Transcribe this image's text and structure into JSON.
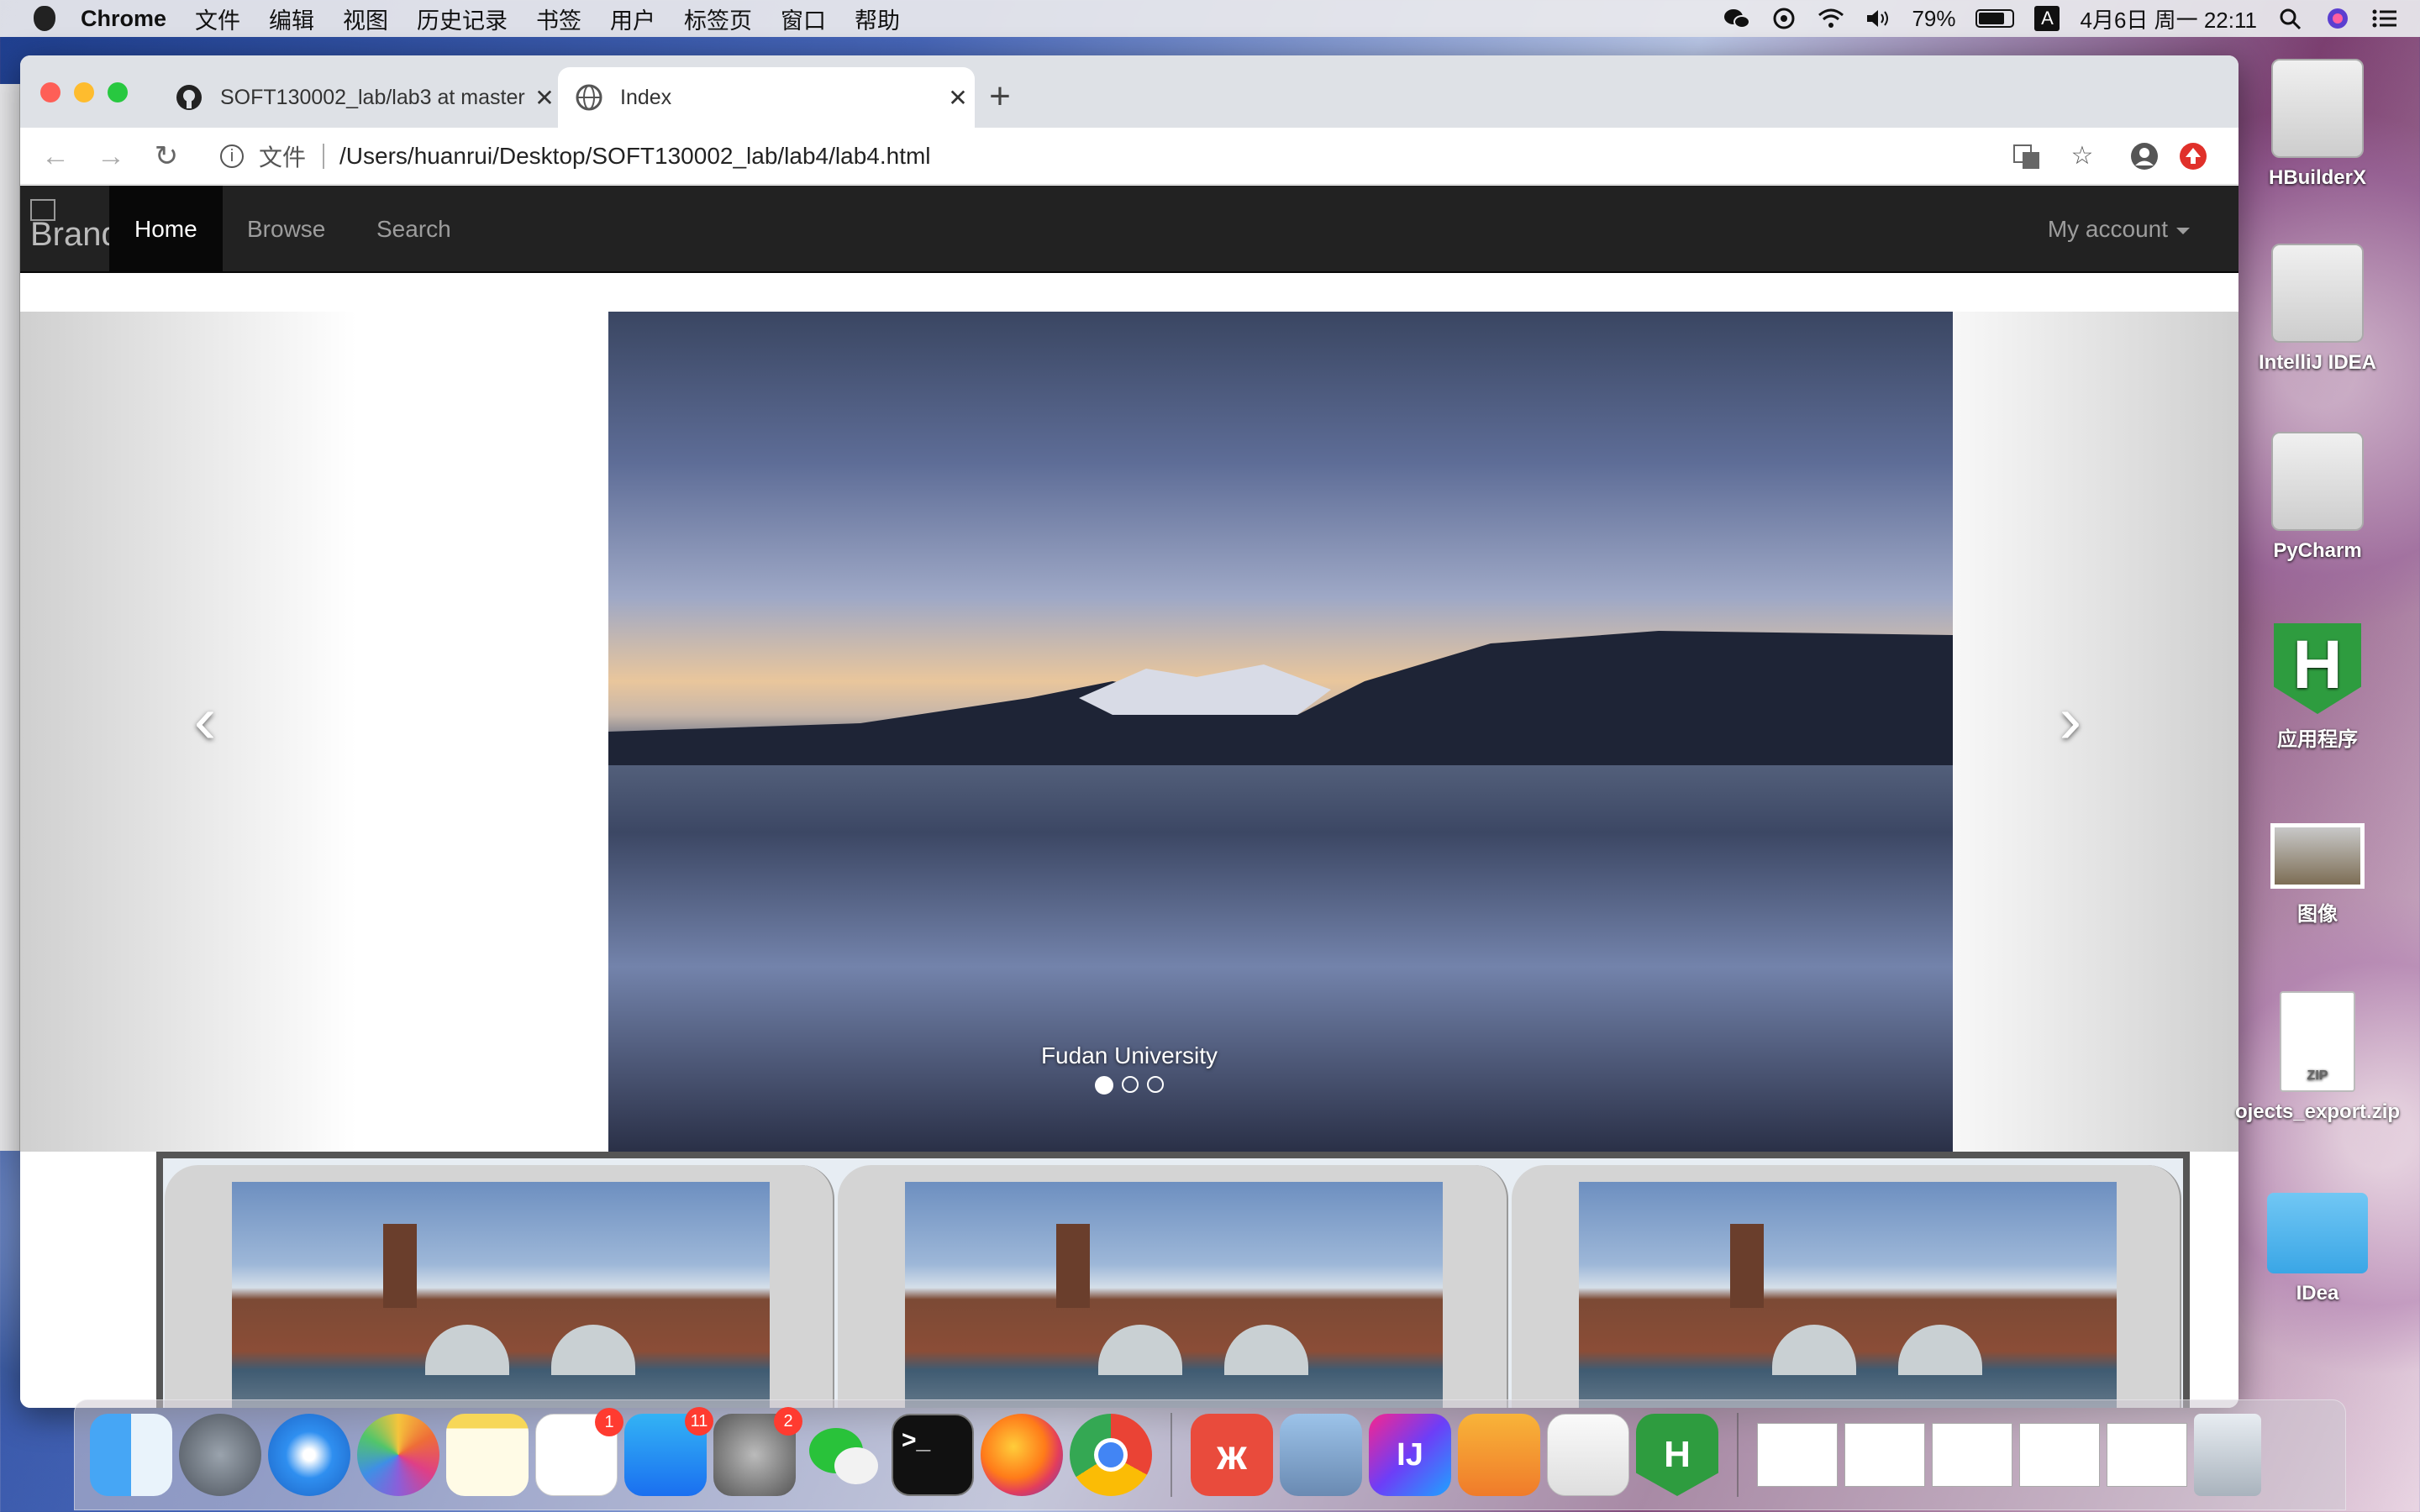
{
  "menubar": {
    "app_name": "Chrome",
    "items": [
      "文件",
      "编辑",
      "视图",
      "历史记录",
      "书签",
      "用户",
      "标签页",
      "窗口",
      "帮助"
    ],
    "battery": "79%",
    "clock": "4月6日 周一  22:11",
    "input_indicator": "A"
  },
  "browser": {
    "tabs": [
      {
        "title": "SOFT130002_lab/lab3 at master",
        "icon": "github-icon"
      },
      {
        "title": "Index",
        "icon": "globe-icon"
      }
    ],
    "address": {
      "scheme_label": "文件",
      "url": "/Users/huanrui/Desktop/SOFT130002_lab/lab4/lab4.html"
    }
  },
  "page": {
    "brand_alt": "Brand",
    "nav": [
      "Home",
      "Browse",
      "Search"
    ],
    "account_label": "My account",
    "carousel": {
      "caption": "Fudan University",
      "indicator_count": 3,
      "active_index": 0
    },
    "thumbnails_count": 3
  },
  "desktop_icons": [
    "HBuilderX",
    "IntelliJ IDEA",
    "PyCharm",
    "应用程序",
    "图像",
    "ojects_export.zip",
    "IDea"
  ],
  "dock": {
    "apps": [
      "finder",
      "launchpad",
      "safari",
      "photos",
      "notes",
      "reminders",
      "app-store",
      "system-preferences",
      "wechat",
      "terminal",
      "firefox",
      "chrome",
      "xmind",
      "preview",
      "intellij",
      "pages",
      "textedit",
      "hbuilder"
    ],
    "badges": {
      "reminders": "1",
      "app-store": "11",
      "system-preferences": "2"
    },
    "terminal_glyph": ">_",
    "intellij_glyph": "IJ",
    "hbuilder_glyph": "H"
  }
}
